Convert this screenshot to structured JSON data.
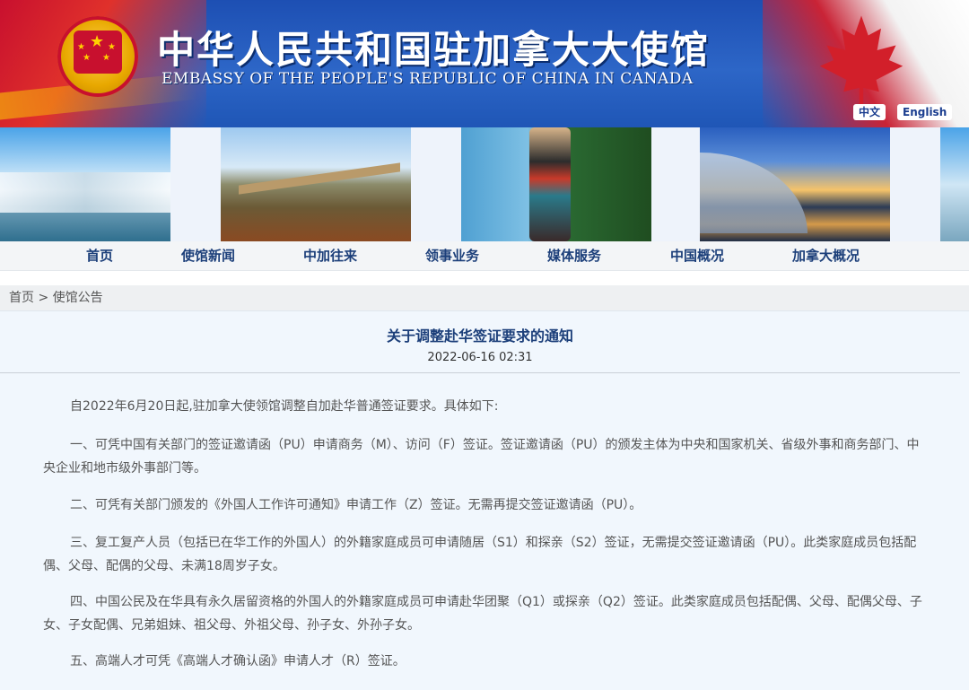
{
  "header": {
    "title_cn": "中华人民共和国驻加拿大大使馆",
    "title_en": "EMBASSY OF THE PEOPLE'S REPUBLIC OF CHINA IN CANADA",
    "lang_cn": "中文",
    "lang_en": "English"
  },
  "nav": {
    "items": [
      "首页",
      "使馆新闻",
      "中加往来",
      "领事业务",
      "媒体服务",
      "中国概况",
      "加拿大概况"
    ]
  },
  "breadcrumb": {
    "home": "首页",
    "separator": ">",
    "current": "使馆公告"
  },
  "article": {
    "title": "关于调整赴华签证要求的通知",
    "date": "2022-06-16 02:31",
    "paragraphs": [
      "自2022年6月20日起,驻加拿大使领馆调整自加赴华普通签证要求。具体如下:",
      "一、可凭中国有关部门的签证邀请函（PU）申请商务（M）、访问（F）签证。签证邀请函（PU）的颁发主体为中央和国家机关、省级外事和商务部门、中央企业和地市级外事部门等。",
      "二、可凭有关部门颁发的《外国人工作许可通知》申请工作（Z）签证。无需再提交签证邀请函（PU）。",
      "三、复工复产人员（包括已在华工作的外国人）的外籍家庭成员可申请随居（S1）和探亲（S2）签证，无需提交签证邀请函（PU）。此类家庭成员包括配偶、父母、配偶的父母、未满18周岁子女。",
      "四、中国公民及在华具有永久居留资格的外国人的外籍家庭成员可申请赴华团聚（Q1）或探亲（Q2）签证。此类家庭成员包括配偶、父母、配偶父母、子女、子女配偶、兄弟姐妹、祖父母、外祖父母、孙子女、外孙子女。",
      "五、高端人才可凭《高端人才确认函》申请人才（R）签证。"
    ]
  }
}
